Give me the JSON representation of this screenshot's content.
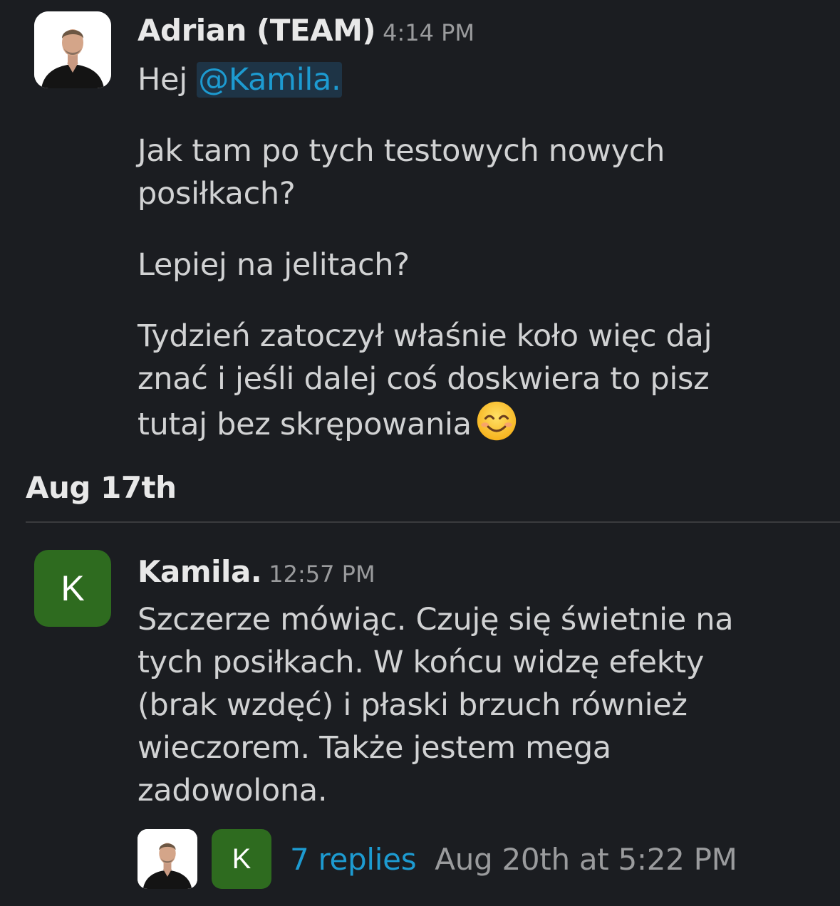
{
  "messages": [
    {
      "author": "Adrian (TEAM)",
      "time": "4:14 PM",
      "avatar": "photo-avatar",
      "greeting": "Hej ",
      "mention": "@Kamila.",
      "paragraphs": [
        "Jak tam po tych testowych nowych posiłkach?",
        "Lepiej na jelitach?",
        "Tydzień zatoczył właśnie koło więc daj znać i jeśli dalej coś doskwiera to pisz tutaj bez skrępowania"
      ],
      "emoji": "smiling-face-icon"
    },
    {
      "author": "Kamila.",
      "time": "12:57 PM",
      "avatar_letter": "K",
      "text": "Szczerze mówiąc. Czuję się świetnie na tych posiłkach. W końcu widzę efekty (brak wzdęć) i płaski brzuch również wieczorem. Także jestem mega zadowolona."
    }
  ],
  "date_divider": "Aug 17th",
  "thread": {
    "avatar_letter": "K",
    "replies_label": "7 replies",
    "last_reply": "Aug 20th at 5:22 PM"
  },
  "colors": {
    "background": "#1b1d21",
    "link": "#1d9bd1",
    "avatar_green": "#2e6b1f"
  }
}
